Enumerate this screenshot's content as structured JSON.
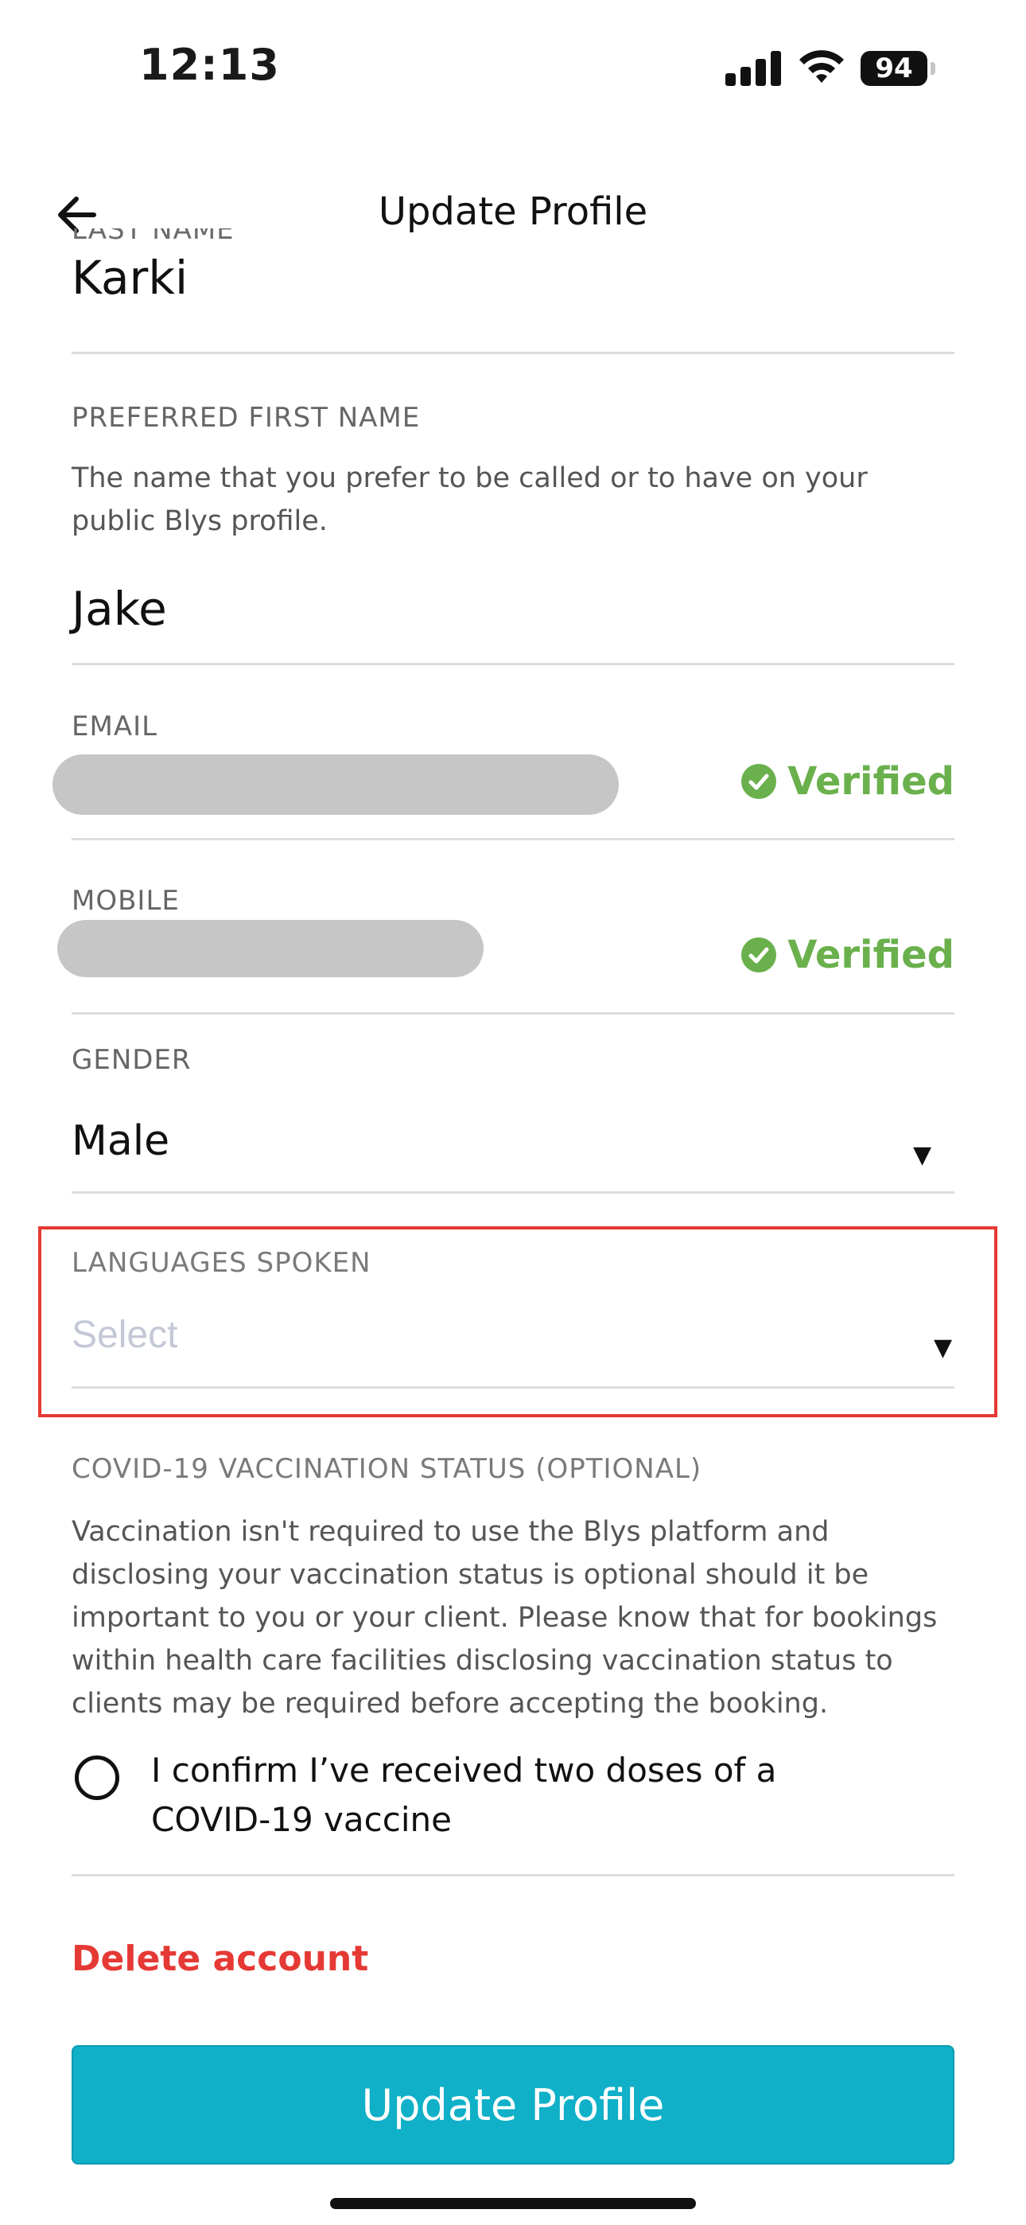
{
  "status_bar": {
    "time": "12:13",
    "battery": "94"
  },
  "header": {
    "title": "Update Profile"
  },
  "last_name": {
    "label": "LAST NAME",
    "value": "Karki"
  },
  "preferred_first_name": {
    "label": "PREFERRED FIRST NAME",
    "help": "The name that you prefer to be called or to have on your public Blys profile.",
    "value": "Jake"
  },
  "email": {
    "label": "EMAIL",
    "status": "Verified"
  },
  "mobile": {
    "label": "MOBILE",
    "status": "Verified"
  },
  "gender": {
    "label": "GENDER",
    "value": "Male"
  },
  "languages": {
    "label": "LANGUAGES SPOKEN",
    "placeholder": "Select"
  },
  "covid": {
    "label": "COVID-19 VACCINATION STATUS (OPTIONAL)",
    "help": "Vaccination isn't required to use the Blys platform and disclosing your vaccination status is optional should it be important to you or your client. Please know that for bookings within health care facilities disclosing vaccination status to clients may be required before accepting the booking.",
    "confirm_text": "I confirm I’ve received two doses of a COVID-19 vaccine"
  },
  "actions": {
    "delete_label": "Delete account",
    "update_label": "Update Profile"
  },
  "colors": {
    "verified": "#6ab04c",
    "accent": "#0fb0c8",
    "danger": "#e53935",
    "highlight": "#e53935"
  }
}
